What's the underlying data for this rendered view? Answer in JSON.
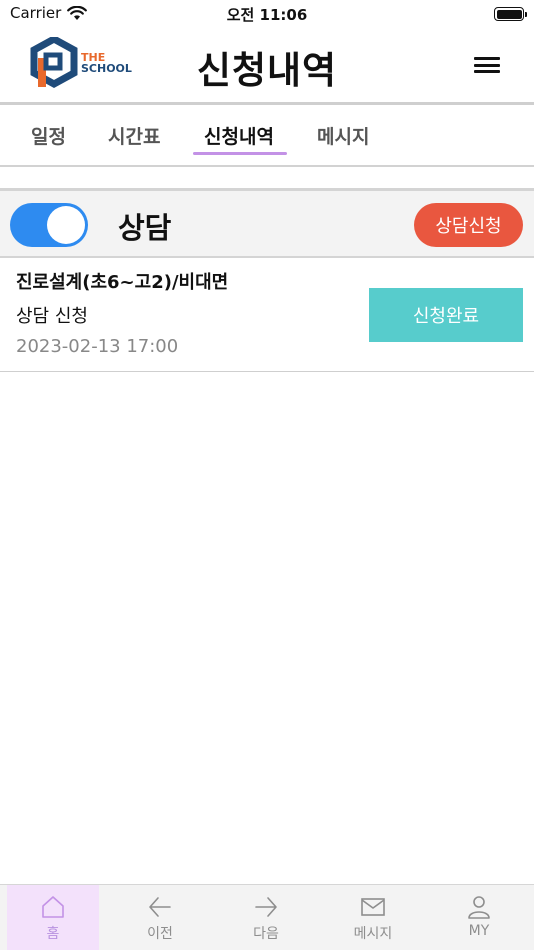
{
  "status_bar": {
    "carrier": "Carrier",
    "time": "오전 11:06"
  },
  "header": {
    "logo_line1": "THE",
    "logo_line2": "SCHOOL",
    "title": "신청내역"
  },
  "tabs": [
    {
      "label": "일정"
    },
    {
      "label": "시간표"
    },
    {
      "label": "신청내역"
    },
    {
      "label": "메시지"
    }
  ],
  "active_tab": "신청내역",
  "section": {
    "title": "상담",
    "toggle_on": true,
    "apply_button": "상담신청"
  },
  "requests": [
    {
      "title": "진로설계(초6~고2)/비대면",
      "type": "상담 신청",
      "datetime": "2023-02-13 17:00",
      "status": "신청완료"
    }
  ],
  "bottom_nav": [
    {
      "label": "홈",
      "icon": "home-icon"
    },
    {
      "label": "이전",
      "icon": "arrow-left-icon"
    },
    {
      "label": "다음",
      "icon": "arrow-right-icon"
    },
    {
      "label": "메시지",
      "icon": "mail-icon"
    },
    {
      "label": "MY",
      "icon": "user-icon"
    }
  ],
  "colors": {
    "accent_purple": "#c392e6",
    "toggle_blue": "#2e8bf0",
    "apply_red": "#e9573f",
    "status_teal": "#57cccc"
  }
}
